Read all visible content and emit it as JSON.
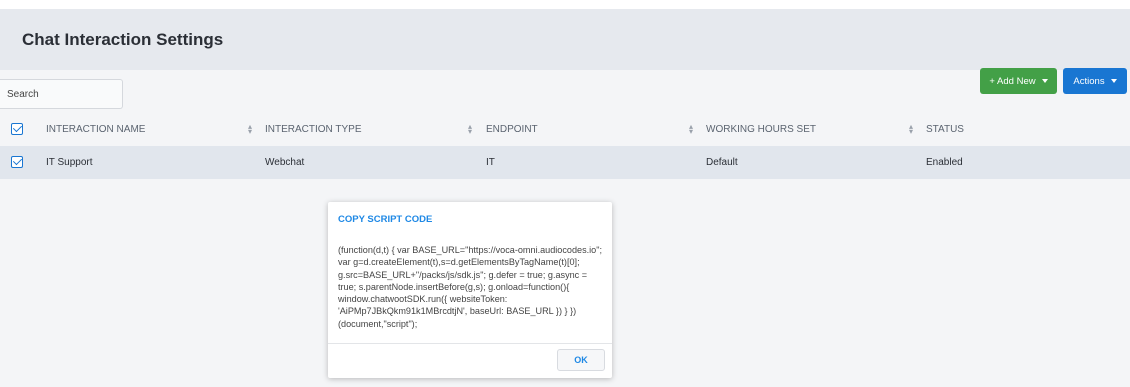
{
  "header": {
    "title": "Chat Interaction Settings"
  },
  "search": {
    "placeholder": "Search"
  },
  "toolbar": {
    "add_new_label": "+ Add New",
    "actions_label": "Actions"
  },
  "table": {
    "columns": [
      "INTERACTION NAME",
      "INTERACTION TYPE",
      "ENDPOINT",
      "WORKING HOURS SET",
      "STATUS"
    ],
    "rows": [
      {
        "name": "IT Support",
        "type": "Webchat",
        "endpoint": "IT",
        "working_hours": "Default",
        "status": "Enabled"
      }
    ]
  },
  "modal": {
    "title": "COPY SCRIPT CODE",
    "script_lines": [
      "(function(d,t) { var BASE_URL=\"https://voca-omni.audiocodes.io\";",
      "var g=d.createElement(t),s=d.getElementsByTagName(t)[0];",
      "g.src=BASE_URL+\"/packs/js/sdk.js\"; g.defer = true; g.async =",
      "true; s.parentNode.insertBefore(g,s); g.onload=function(){",
      "window.chatwootSDK.run({ websiteToken:",
      "'AiPMp7JBkQkm91k1MBrcdtjN', baseUrl: BASE_URL }) } })",
      "(document,\"script\");"
    ],
    "ok_label": "OK"
  },
  "colors": {
    "add_button": "#43a047",
    "actions_button": "#1976d2",
    "accent": "#1e88e5"
  }
}
